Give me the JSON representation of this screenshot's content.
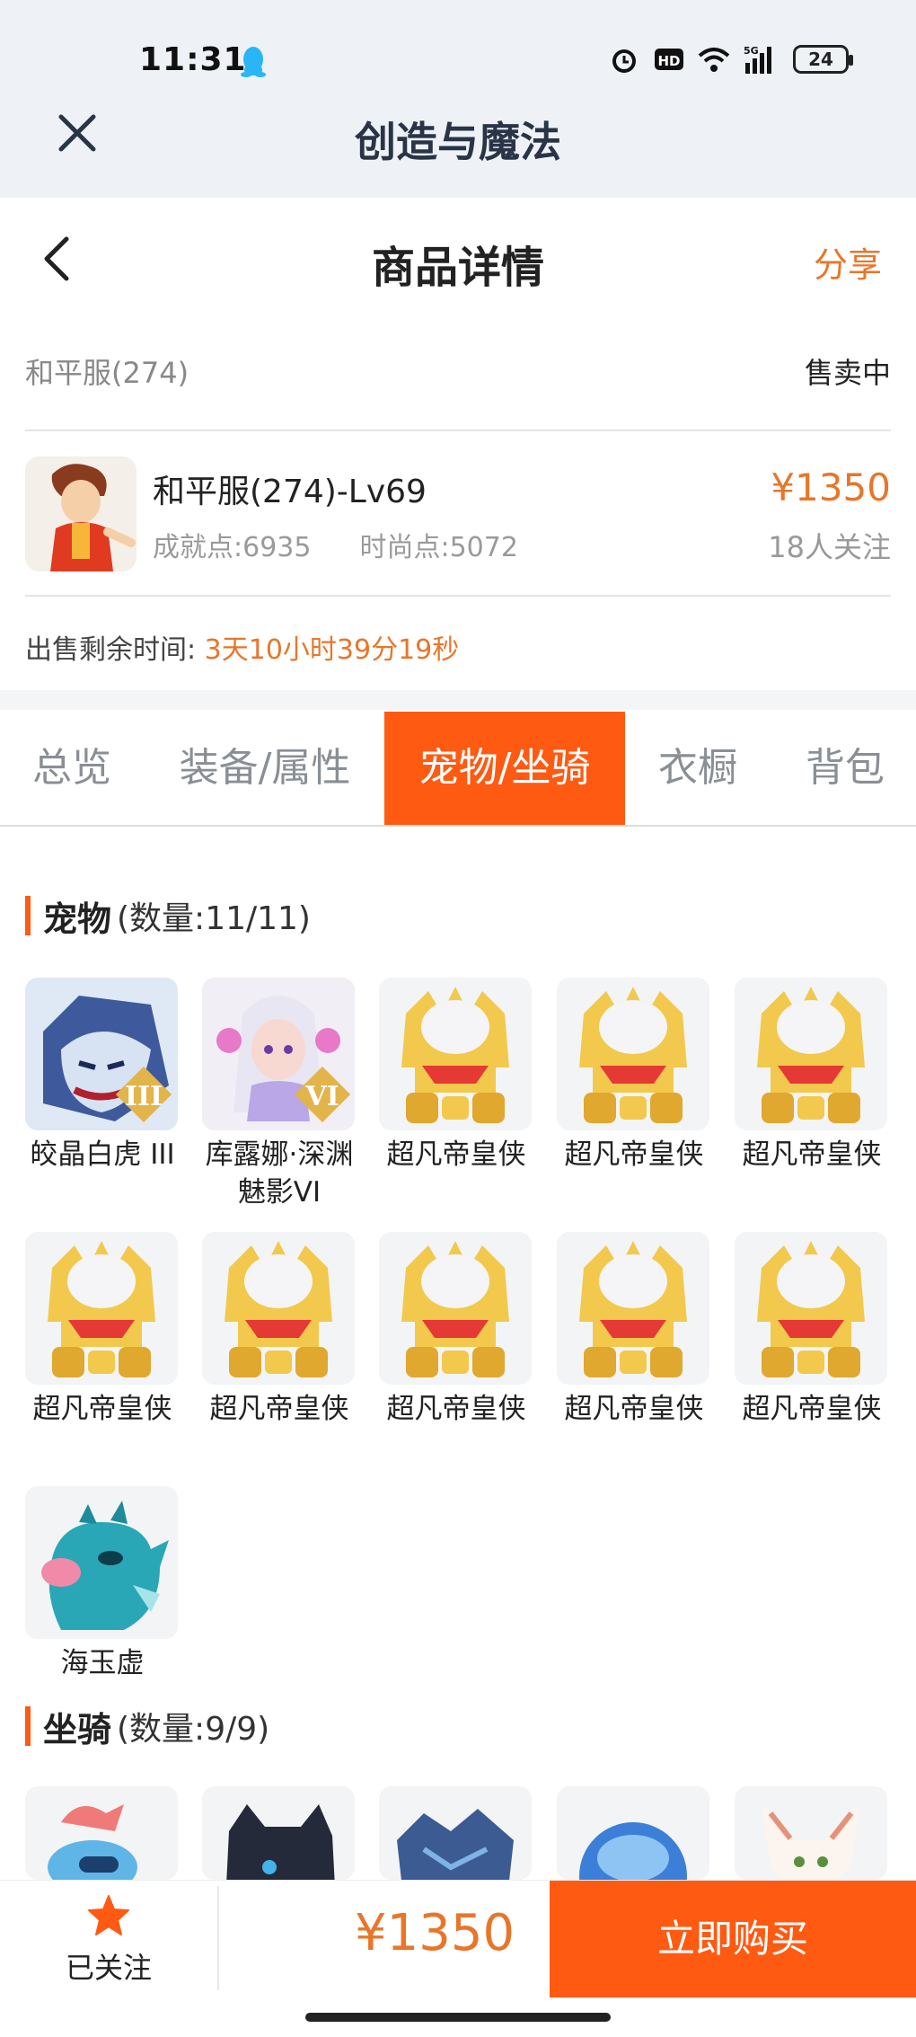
{
  "status": {
    "time": "11:31",
    "battery": "24",
    "signal": "5G"
  },
  "app": {
    "title": "创造与魔法"
  },
  "nav": {
    "title": "商品详情",
    "share": "分享"
  },
  "server": {
    "name": "和平服(274)",
    "status": "售卖中"
  },
  "product": {
    "title": "和平服(274)-Lv69",
    "achievement": "成就点:6935",
    "fashion": "时尚点:5072",
    "price": "¥1350",
    "followers": "18人关注"
  },
  "remain": {
    "label": "出售剩余时间:",
    "value": "3天10小时39分19秒"
  },
  "tabs": [
    {
      "label": "总览"
    },
    {
      "label": "装备/属性"
    },
    {
      "label": "宠物/坐骑"
    },
    {
      "label": "衣橱"
    },
    {
      "label": "背包"
    }
  ],
  "active_tab": "宠物/坐骑",
  "pets": {
    "title": "宠物",
    "count": "(数量:11/11)",
    "items": [
      {
        "label": "皎晶白虎 III",
        "icon": "white-tiger-icon"
      },
      {
        "label": "库露娜·深渊魅影VI",
        "icon": "kuluna-icon"
      },
      {
        "label": "超凡帝皇侠",
        "icon": "golden-emperor-icon"
      },
      {
        "label": "超凡帝皇侠",
        "icon": "golden-emperor-icon"
      },
      {
        "label": "超凡帝皇侠",
        "icon": "golden-emperor-icon"
      },
      {
        "label": "超凡帝皇侠",
        "icon": "golden-emperor-icon"
      },
      {
        "label": "超凡帝皇侠",
        "icon": "golden-emperor-icon"
      },
      {
        "label": "超凡帝皇侠",
        "icon": "golden-emperor-icon"
      },
      {
        "label": "超凡帝皇侠",
        "icon": "golden-emperor-icon"
      },
      {
        "label": "超凡帝皇侠",
        "icon": "golden-emperor-icon"
      },
      {
        "label": "海玉虚",
        "icon": "sea-dragon-icon"
      }
    ]
  },
  "mounts": {
    "title": "坐骑",
    "count": "(数量:9/9)"
  },
  "bottom": {
    "follow": "已关注",
    "price": "¥1350",
    "buy": "立即购买"
  },
  "colors": {
    "accent": "#ff5a12",
    "price": "#e8762a"
  }
}
